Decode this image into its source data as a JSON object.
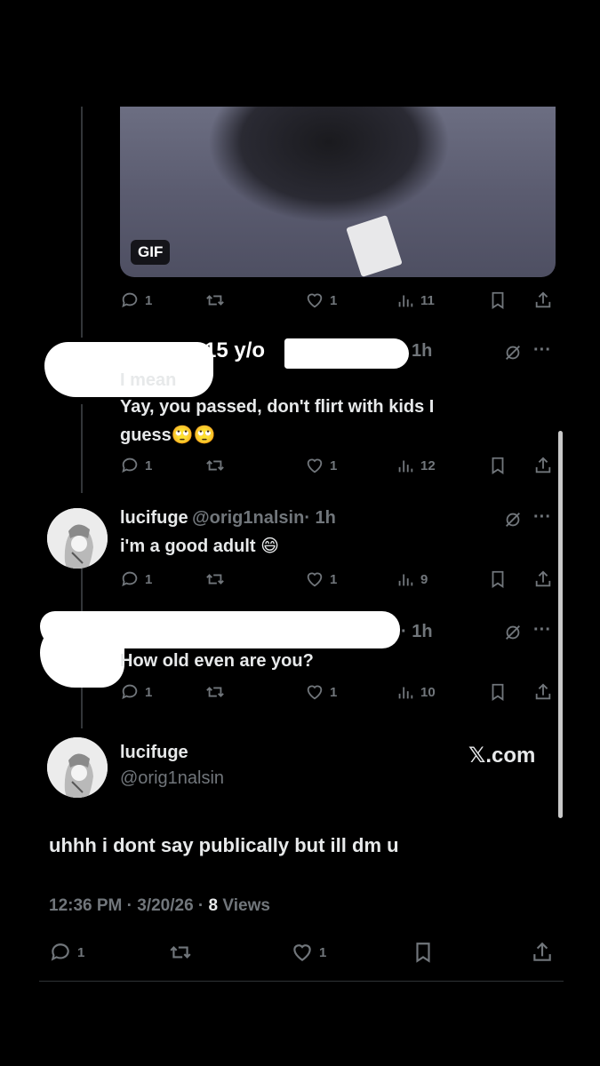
{
  "gif": {
    "badge": "GIF"
  },
  "tweet1": {
    "actions": {
      "replies": "1",
      "likes": "1",
      "views": "11"
    }
  },
  "tweet2": {
    "redaction_label": "15 y/o",
    "time": "1h",
    "text_line1": "I mean",
    "text_line2": "Yay, you passed, don't flirt with kids I",
    "text_line3": "guess🙄🙄",
    "actions": {
      "replies": "1",
      "likes": "1",
      "views": "12"
    }
  },
  "tweet3": {
    "name": "lucifuge",
    "handle": "@orig1nalsin",
    "time": "· 1h",
    "text": "i'm a good adult 😄",
    "actions": {
      "replies": "1",
      "likes": "1",
      "views": "9"
    }
  },
  "tweet4": {
    "time": "· 1h",
    "text": "How old even are you?",
    "actions": {
      "replies": "1",
      "likes": "1",
      "views": "10"
    }
  },
  "main": {
    "name": "lucifuge",
    "handle": "@orig1nalsin",
    "brand": "𝕏.com",
    "text": "uhhh i dont say publically but ill dm u",
    "timestamp": "12:36 PM · 3/20/26 · ",
    "views_count": "8",
    "views_label": " Views",
    "actions": {
      "replies": "1",
      "likes": "1"
    }
  },
  "colors": {
    "background": "#000000",
    "text": "#e7e9ea",
    "muted": "#71767b"
  }
}
